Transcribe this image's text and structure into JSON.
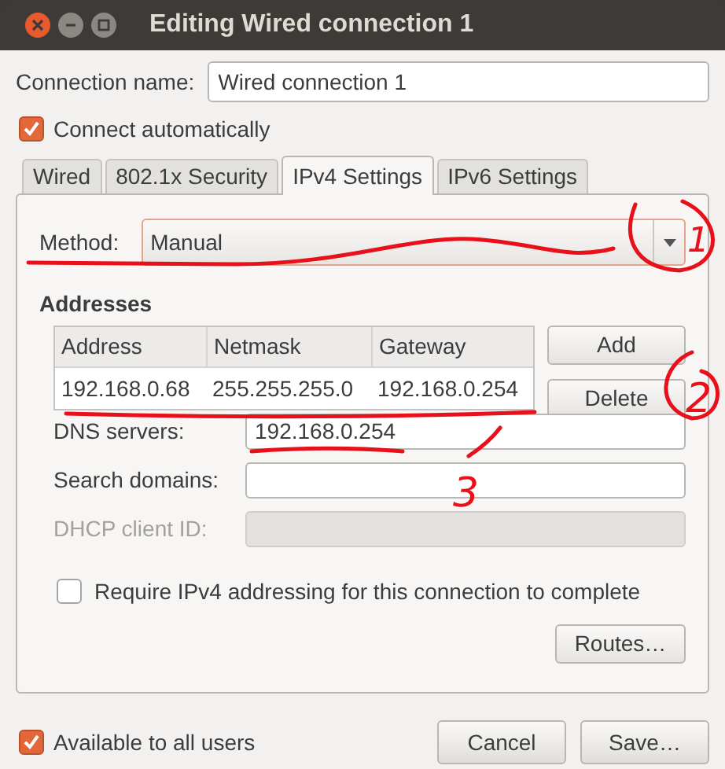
{
  "window": {
    "title": "Editing Wired connection 1"
  },
  "connection_name": {
    "label": "Connection name:",
    "value": "Wired connection 1"
  },
  "connect_automatically": {
    "label": "Connect automatically",
    "checked": true
  },
  "tabs": [
    {
      "label": "Wired",
      "selected": false
    },
    {
      "label": "802.1x Security",
      "selected": false
    },
    {
      "label": "IPv4 Settings",
      "selected": true
    },
    {
      "label": "IPv6 Settings",
      "selected": false
    }
  ],
  "ipv4": {
    "method": {
      "label": "Method:",
      "value": "Manual"
    },
    "addresses": {
      "title": "Addresses",
      "columns": [
        "Address",
        "Netmask",
        "Gateway"
      ],
      "rows": [
        [
          "192.168.0.68",
          "255.255.255.0",
          "192.168.0.254"
        ]
      ],
      "buttons": [
        "Add",
        "Delete"
      ]
    },
    "fields": [
      {
        "label": "DNS servers:",
        "value": "192.168.0.254",
        "disabled": false
      },
      {
        "label": "Search domains:",
        "disabled": false
      },
      {
        "label": "DHCP client ID:",
        "disabled": true
      }
    ],
    "require": {
      "label": "Require IPv4 addressing for this connection to complete",
      "checked": false
    },
    "routes_button": "Routes…"
  },
  "available_to_all": {
    "label": "Available to all users",
    "checked": true
  },
  "buttons": [
    "Cancel",
    "Save…"
  ],
  "annotations": [
    {
      "label": "1"
    },
    {
      "label": "2"
    },
    {
      "label": "3"
    }
  ]
}
